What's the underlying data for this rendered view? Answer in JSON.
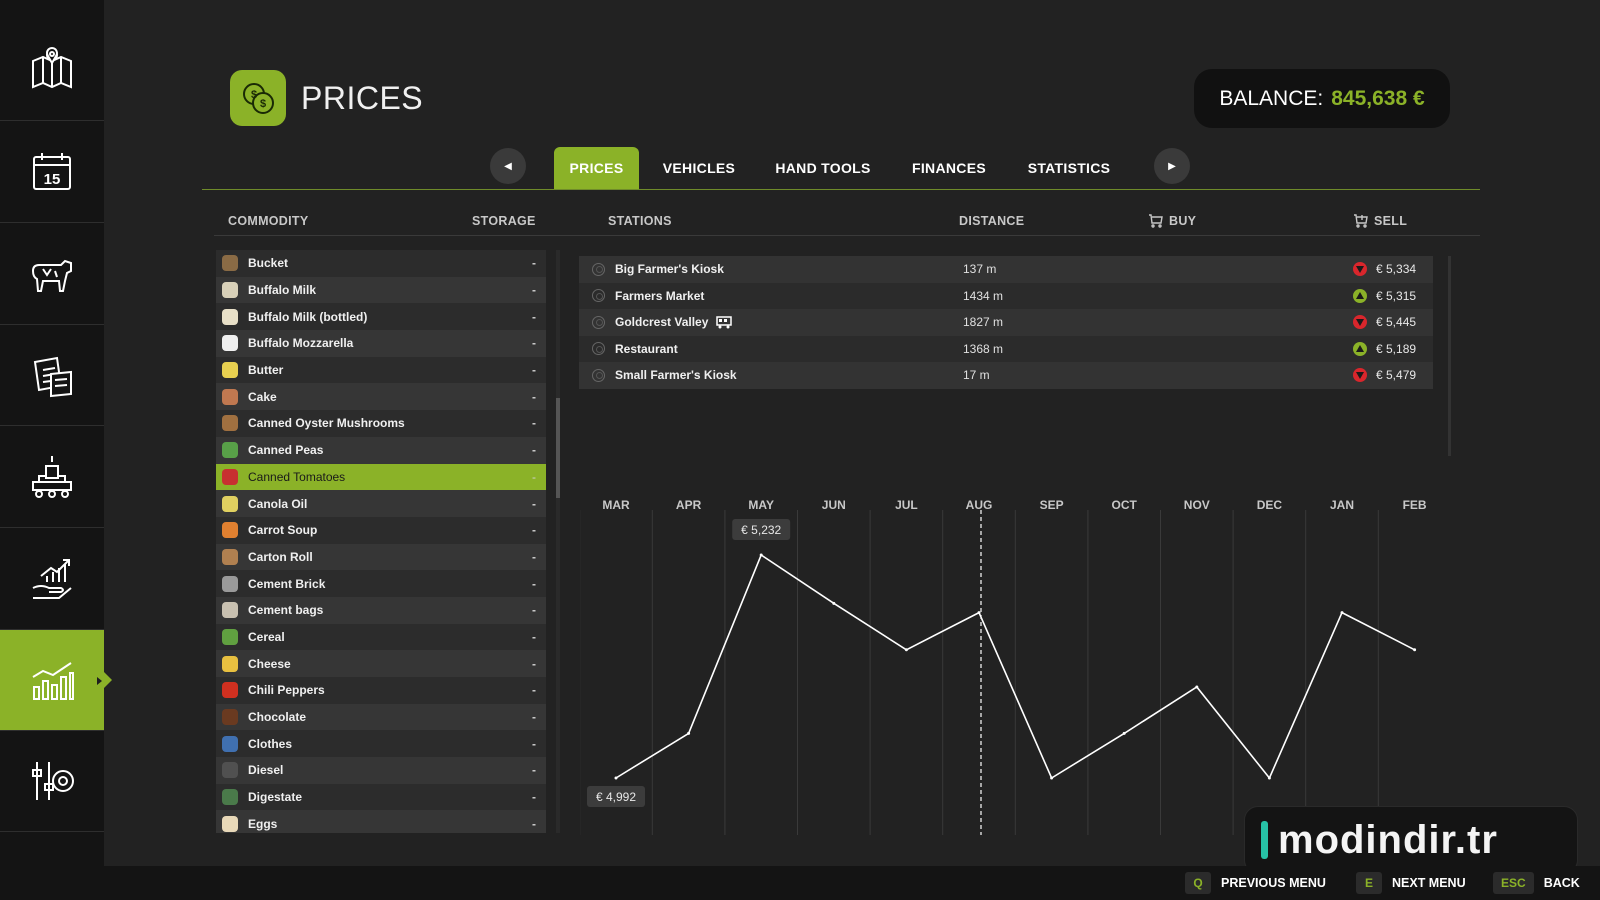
{
  "header": {
    "title": "PRICES",
    "balance_label": "BALANCE:",
    "balance_value": "845,638 €"
  },
  "sidebar": {
    "items": [
      {
        "icon": "map-icon"
      },
      {
        "icon": "calendar-icon",
        "text": "15"
      },
      {
        "icon": "cow-icon"
      },
      {
        "icon": "contracts-icon"
      },
      {
        "icon": "production-icon"
      },
      {
        "icon": "finance-growth-icon"
      },
      {
        "icon": "prices-chart-icon",
        "active": true
      },
      {
        "icon": "settings-icon"
      }
    ]
  },
  "tabs": [
    {
      "label": "PRICES",
      "active": true
    },
    {
      "label": "VEHICLES"
    },
    {
      "label": "HAND TOOLS"
    },
    {
      "label": "FINANCES"
    },
    {
      "label": "STATISTICS"
    }
  ],
  "columns": {
    "commodity": "COMMODITY",
    "storage": "STORAGE",
    "stations": "STATIONS",
    "distance": "DISTANCE",
    "buy": "BUY",
    "sell": "SELL"
  },
  "commodities": [
    {
      "name": "Bucket",
      "storage": "-",
      "color": "#8a6b45"
    },
    {
      "name": "Buffalo Milk",
      "storage": "-",
      "color": "#d8d0b8"
    },
    {
      "name": "Buffalo Milk (bottled)",
      "storage": "-",
      "color": "#e8e0c8"
    },
    {
      "name": "Buffalo Mozzarella",
      "storage": "-",
      "color": "#f0f0f0"
    },
    {
      "name": "Butter",
      "storage": "-",
      "color": "#e8d050"
    },
    {
      "name": "Cake",
      "storage": "-",
      "color": "#c07850"
    },
    {
      "name": "Canned Oyster Mushrooms",
      "storage": "-",
      "color": "#a07040"
    },
    {
      "name": "Canned Peas",
      "storage": "-",
      "color": "#58a048"
    },
    {
      "name": "Canned Tomatoes",
      "storage": "-",
      "color": "#c83030",
      "selected": true
    },
    {
      "name": "Canola Oil",
      "storage": "-",
      "color": "#e0d060"
    },
    {
      "name": "Carrot Soup",
      "storage": "-",
      "color": "#e08030"
    },
    {
      "name": "Carton Roll",
      "storage": "-",
      "color": "#b08050"
    },
    {
      "name": "Cement Brick",
      "storage": "-",
      "color": "#9a9a9a"
    },
    {
      "name": "Cement bags",
      "storage": "-",
      "color": "#c8c0b0"
    },
    {
      "name": "Cereal",
      "storage": "-",
      "color": "#60a040"
    },
    {
      "name": "Cheese",
      "storage": "-",
      "color": "#e8c040"
    },
    {
      "name": "Chili Peppers",
      "storage": "-",
      "color": "#d03020"
    },
    {
      "name": "Chocolate",
      "storage": "-",
      "color": "#6a3a20"
    },
    {
      "name": "Clothes",
      "storage": "-",
      "color": "#4070b0"
    },
    {
      "name": "Diesel",
      "storage": "-",
      "color": "#505050"
    },
    {
      "name": "Digestate",
      "storage": "-",
      "color": "#4a7a4a"
    },
    {
      "name": "Eggs",
      "storage": "-",
      "color": "#e8d8b8"
    }
  ],
  "stations": [
    {
      "name": "Big Farmer's Kiosk",
      "distance": "137 m",
      "trend": "down",
      "price": "€ 5,334"
    },
    {
      "name": "Farmers Market",
      "distance": "1434 m",
      "trend": "up",
      "price": "€ 5,315"
    },
    {
      "name": "Goldcrest Valley",
      "distance": "1827 m",
      "trend": "down",
      "price": "€ 5,445",
      "train": true
    },
    {
      "name": "Restaurant",
      "distance": "1368 m",
      "trend": "up",
      "price": "€ 5,189"
    },
    {
      "name": "Small Farmer's Kiosk",
      "distance": "17 m",
      "trend": "down",
      "price": "€ 5,479"
    }
  ],
  "chart_data": {
    "type": "line",
    "categories": [
      "MAR",
      "APR",
      "MAY",
      "JUN",
      "JUL",
      "AUG",
      "SEP",
      "OCT",
      "NOV",
      "DEC",
      "JAN",
      "FEB"
    ],
    "values": [
      4992,
      5040,
      5232,
      5180,
      5130,
      5170,
      4992,
      5040,
      5090,
      4992,
      5170,
      5130
    ],
    "min_label": "€ 4,992",
    "max_label": "€ 5,232",
    "current_month_index": 5
  },
  "footer": {
    "hints": [
      {
        "key": "Q",
        "label": "PREVIOUS MENU"
      },
      {
        "key": "E",
        "label": "NEXT MENU"
      },
      {
        "key": "ESC",
        "label": "BACK"
      }
    ]
  },
  "watermark": "modindir.tr",
  "colors": {
    "accent": "#8bb228",
    "trend_down": "#d9262c",
    "trend_up": "#8bb228",
    "background": "#222222",
    "sidebar": "#141414"
  }
}
